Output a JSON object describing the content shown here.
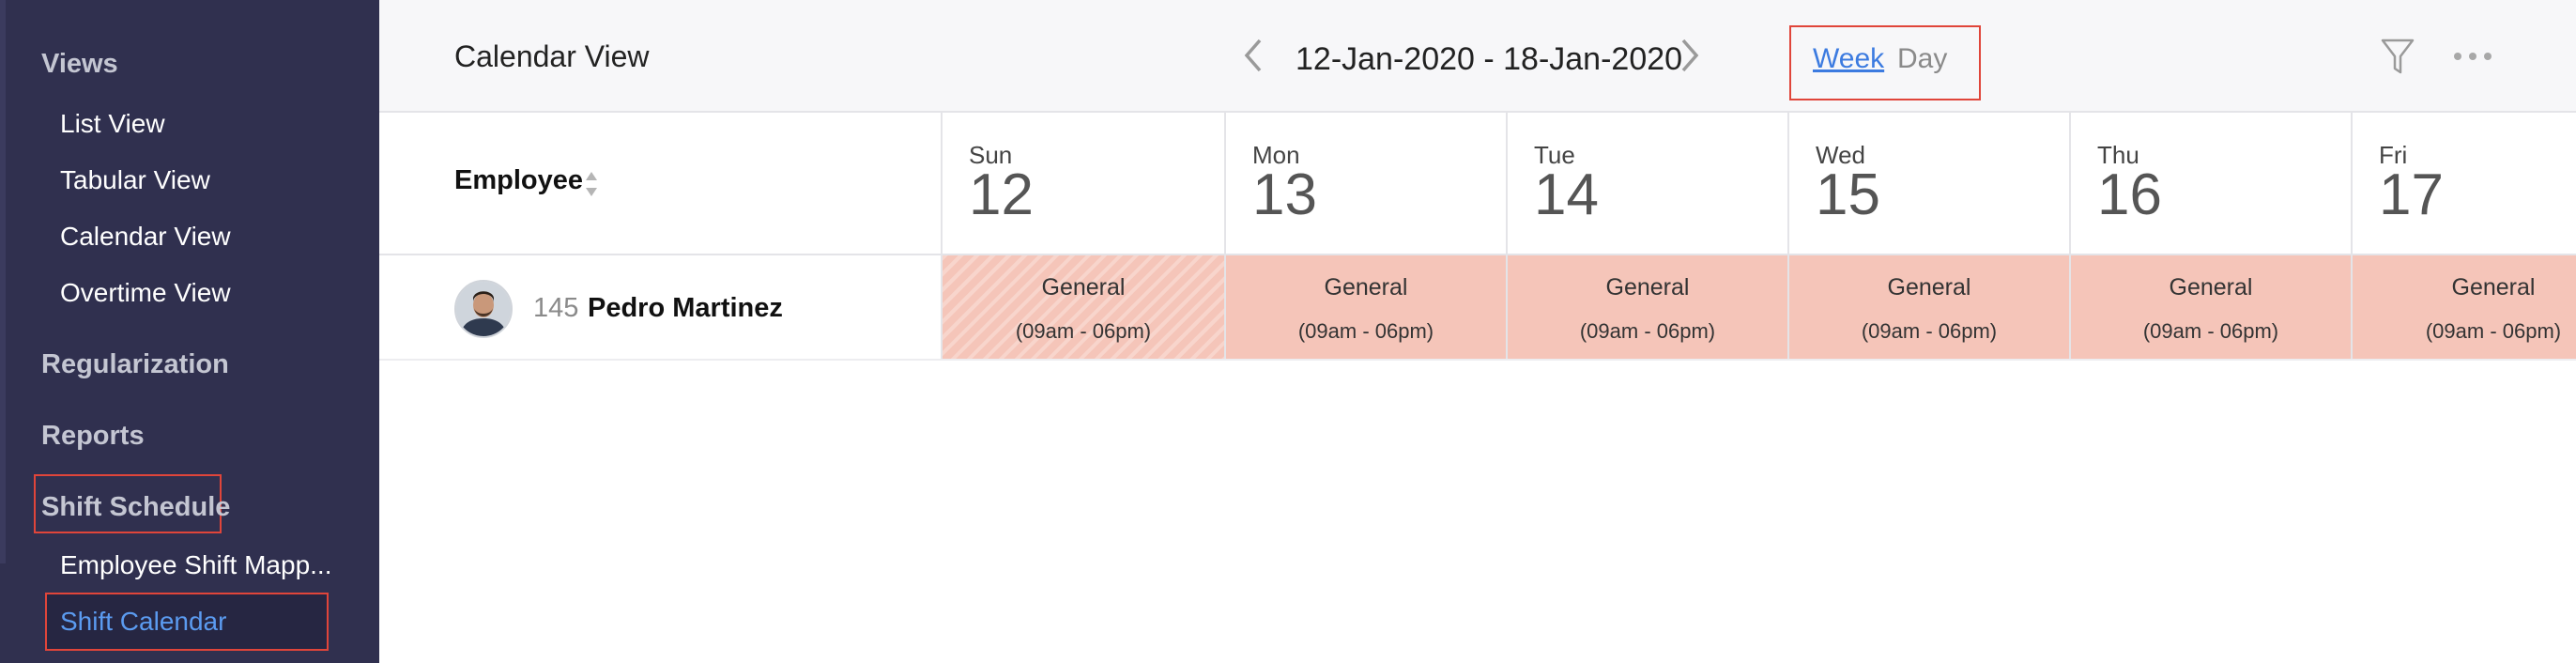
{
  "sidebar": {
    "views_heading": "Views",
    "views_items": [
      {
        "label": "List View"
      },
      {
        "label": "Tabular View"
      },
      {
        "label": "Calendar View"
      },
      {
        "label": "Overtime View"
      }
    ],
    "regularization": "Regularization",
    "reports": "Reports",
    "shift_schedule": "Shift Schedule",
    "shift_items": [
      {
        "label": "Employee Shift Mapp..."
      },
      {
        "label": "Shift Calendar"
      }
    ]
  },
  "header": {
    "title": "Calendar View",
    "date_range": "12-Jan-2020 - 18-Jan-2020",
    "week_label": "Week",
    "day_label": "Day"
  },
  "grid": {
    "employee_header": "Employee",
    "days": [
      {
        "name": "Sun",
        "num": "12"
      },
      {
        "name": "Mon",
        "num": "13"
      },
      {
        "name": "Tue",
        "num": "14"
      },
      {
        "name": "Wed",
        "num": "15"
      },
      {
        "name": "Thu",
        "num": "16"
      },
      {
        "name": "Fri",
        "num": "17"
      }
    ],
    "employee": {
      "id": "145",
      "name": "Pedro Martinez"
    },
    "shifts": [
      {
        "name": "General",
        "time": "(09am - 06pm)"
      },
      {
        "name": "General",
        "time": "(09am - 06pm)"
      },
      {
        "name": "General",
        "time": "(09am - 06pm)"
      },
      {
        "name": "General",
        "time": "(09am - 06pm)"
      },
      {
        "name": "General",
        "time": "(09am - 06pm)"
      },
      {
        "name": "General",
        "time": "(09am - 06pm)"
      }
    ]
  },
  "colors": {
    "sidebar_bg": "#30304f",
    "accent_blue": "#3c7be0",
    "highlight_red": "#e0453a",
    "shift_fill": "#f5c5b9"
  }
}
